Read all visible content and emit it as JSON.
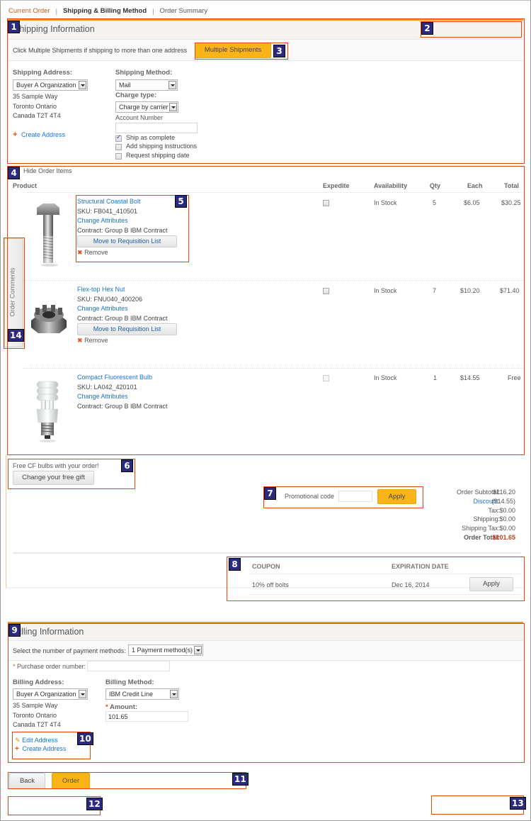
{
  "breadcrumb": {
    "items": [
      "Current Order",
      "Shipping & Billing Method",
      "Order Summary"
    ],
    "separator": "|"
  },
  "shipping": {
    "title": "Shipping Information",
    "multi_prompt": "Click Multiple Shipments if shipping to more than one address",
    "multi_button": "Multiple Shipments",
    "address_label": "Shipping Address:",
    "address_select": "Buyer A Organization",
    "address_lines": [
      "35 Sample Way",
      "Toronto Ontario",
      "Canada T2T 4T4"
    ],
    "create_address": "Create Address",
    "method_label": "Shipping Method:",
    "method_select": "Mail",
    "charge_label": "Charge type:",
    "charge_select": "Charge by carrier",
    "account_label": "Account Number",
    "account_value": "",
    "options": [
      {
        "label": "Ship as complete",
        "checked": true
      },
      {
        "label": "Add shipping instructions",
        "checked": false
      },
      {
        "label": "Request shipping date",
        "checked": false
      }
    ]
  },
  "items": {
    "toggle": "Hide Order Items",
    "columns": [
      "Product",
      "Expedite",
      "Availability",
      "Qty",
      "Each",
      "Total"
    ],
    "rows": [
      {
        "name": "Structural Coastal Bolt",
        "sku": "SKU: FB041_410501",
        "change": "Change Attributes",
        "contract": "Contract: Group B IBM Contract",
        "move": "Move to Requisition List",
        "remove": "Remove",
        "availability": "In Stock",
        "qty": "5",
        "each": "$6.05",
        "total": "$30.25",
        "image": "bolt"
      },
      {
        "name": "Flex-top Hex Nut",
        "sku": "SKU: FNU040_400206",
        "change": "Change Attributes",
        "contract": "Contract: Group B IBM Contract",
        "move": "Move to Requisition List",
        "remove": "Remove",
        "availability": "In Stock",
        "qty": "7",
        "each": "$10.20",
        "total": "$71.40",
        "image": "hex-nut"
      },
      {
        "name": "Compact Fluorescent Bulb",
        "sku": "SKU: LA042_420101",
        "change": "Change Attributes",
        "contract": "Contract: Group B IBM Contract",
        "availability": "In Stock",
        "qty": "1",
        "each": "$14.55",
        "total": "Free",
        "image": "cfl-bulb"
      }
    ]
  },
  "order_comments": "Order Comments",
  "gift": {
    "message": "Free CF bulbs with your order!",
    "button": "Change your free gift"
  },
  "promo": {
    "label": "Promotional code",
    "value": "",
    "button": "Apply"
  },
  "summary": {
    "rows": [
      {
        "label": "Order Subtotal:",
        "value": "$116.20"
      },
      {
        "label": "Discount:",
        "value": "($14.55)"
      },
      {
        "label": "Tax:",
        "value": "$0.00"
      },
      {
        "label": "Shipping:",
        "value": "$0.00"
      },
      {
        "label": "Shipping Tax:",
        "value": "$0.00"
      },
      {
        "label": "Order Total:",
        "value": "$101.65"
      }
    ]
  },
  "coupons": {
    "columns": [
      "COUPON",
      "EXPIRATION DATE"
    ],
    "rows": [
      {
        "coupon": "10% off bolts",
        "expires": "Dec 16, 2014",
        "button": "Apply"
      }
    ]
  },
  "billing": {
    "title": "Billing Information",
    "payment_count_label": "Select the number of payment methods:",
    "payment_count_select": "1 Payment method(s)",
    "po_label": "Purchase order number:",
    "po_value": "",
    "address_label": "Billing Address:",
    "address_select": "Buyer A Organization",
    "address_lines": [
      "35 Sample Way",
      "Toronto Ontario",
      "Canada T2T 4T4"
    ],
    "method_label": "Billing Method:",
    "method_select": "IBM Credit Line",
    "amount_label": "Amount:",
    "amount_value": "101.65",
    "edit_address": "Edit Address",
    "create_address": "Create Address"
  },
  "actions": {
    "back": "Back",
    "order": "Order"
  },
  "annotations": [
    "1",
    "2",
    "3",
    "4",
    "5",
    "6",
    "7",
    "8",
    "9",
    "10",
    "11",
    "12",
    "13",
    "14"
  ],
  "colors": {
    "accent_orange": "#fbb418",
    "annotation_border": "#e8450f",
    "annotation_badge": "#2b2a7e",
    "link_blue": "#1d74c9",
    "order_total_red": "#c8401a"
  }
}
